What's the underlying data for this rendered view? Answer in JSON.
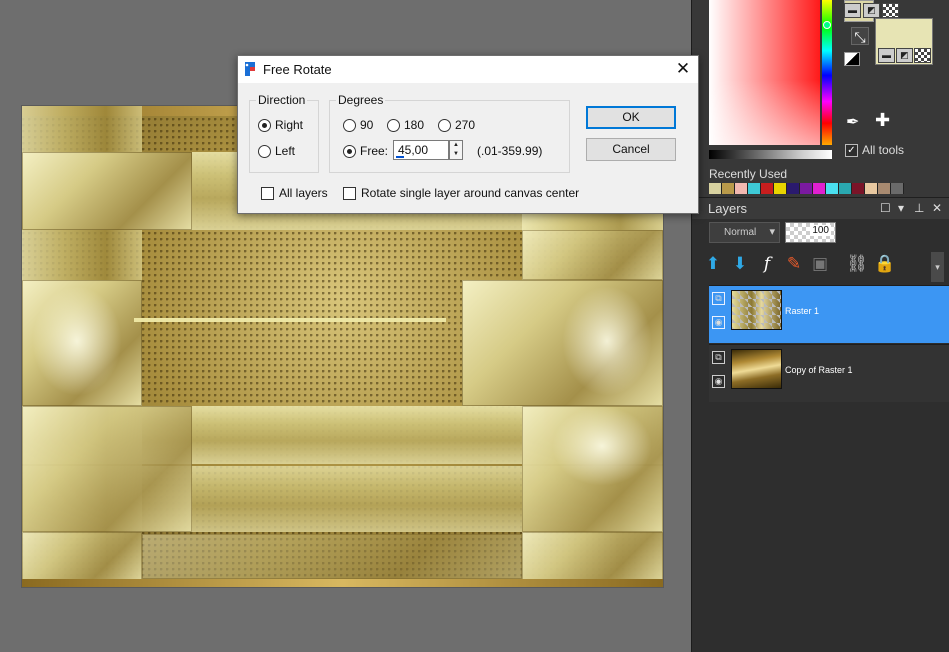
{
  "dialog": {
    "title": "Free Rotate",
    "direction": {
      "label": "Direction",
      "options": [
        "Right",
        "Left"
      ],
      "selected": "Right"
    },
    "degrees": {
      "label": "Degrees",
      "options": [
        "90",
        "180",
        "270"
      ],
      "free_label": "Free:",
      "free_value": "45,00",
      "range": "(.01-359.99)",
      "selected": "Free"
    },
    "all_layers_label": "All layers",
    "all_layers_checked": false,
    "rotate_single_label": "Rotate single layer around canvas center",
    "rotate_single_checked": false,
    "ok_label": "OK",
    "cancel_label": "Cancel",
    "close_glyph": "✕"
  },
  "materials": {
    "all_tools_label": "All tools",
    "all_tools_checked": true,
    "recently_used_label": "Recently Used",
    "recent_colors": [
      "#d8d2a0",
      "#b99a4a",
      "#f2b8b0",
      "#3ec9d6",
      "#c81e1e",
      "#e8d400",
      "#2a1a6e",
      "#7a1aa0",
      "#e020d0",
      "#4ae0f0",
      "#2aa8b0",
      "#7a1428",
      "#e8c8a0",
      "#a88a70",
      "#6a6a6a"
    ],
    "foreground_color": "#ddd8a8",
    "background_color": "#e7e4b4"
  },
  "layers": {
    "title": "Layers",
    "blend_mode": "Normal",
    "opacity": "100",
    "items": [
      {
        "name": "Raster 1",
        "selected": true
      },
      {
        "name": "Copy of Raster 1",
        "selected": false
      }
    ]
  }
}
